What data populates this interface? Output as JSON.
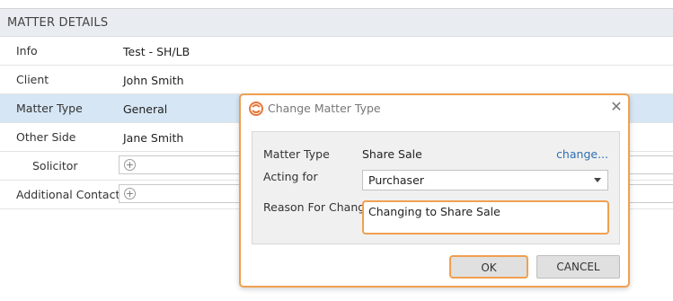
{
  "section": {
    "title": "MATTER DETAILS"
  },
  "rows": [
    {
      "label": "Info",
      "value": "Test - SH/LB"
    },
    {
      "label": "Client",
      "value": "John Smith"
    },
    {
      "label": "Matter Type",
      "value": "General"
    },
    {
      "label": "Other Side",
      "value": "Jane Smith"
    },
    {
      "label": "Solicitor"
    },
    {
      "label": "Additional Contact"
    }
  ],
  "dialog": {
    "title": "Change Matter Type",
    "matter_type_label": "Matter Type",
    "matter_type_value": "Share Sale",
    "change_link": "change...",
    "acting_for_label": "Acting for",
    "acting_for_value": "Purchaser",
    "reason_label": "Reason For Change",
    "reason_value": "Changing to Share Sale",
    "ok_label": "OK",
    "cancel_label": "CANCEL"
  },
  "colors": {
    "accent": "#f0a050",
    "selected_row": "#d6e6f4",
    "link": "#2f6fb0",
    "header_bg": "#e9edf1"
  },
  "icons": {
    "logo": "app-logo-icon",
    "close": "close-icon",
    "add": "plus-circle-icon",
    "dropdown": "chevron-down-icon"
  }
}
